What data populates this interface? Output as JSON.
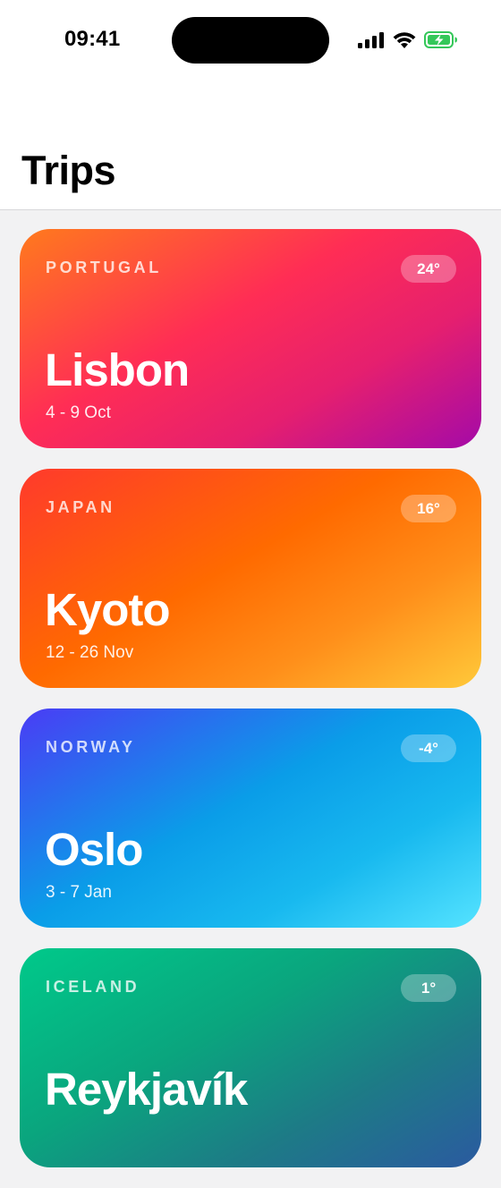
{
  "status_bar": {
    "time": "09:41",
    "icons": [
      "signal-icon",
      "wifi-icon",
      "battery-charging-icon"
    ],
    "battery_color": "#34c759"
  },
  "header": {
    "title": "Trips"
  },
  "trips": [
    {
      "country": "PORTUGAL",
      "city": "Lisbon",
      "dates": "4 - 9 Oct",
      "temperature": "24°",
      "gradient": [
        "#ff7a1d",
        "#ff2d55",
        "#a40aa8"
      ]
    },
    {
      "country": "JAPAN",
      "city": "Kyoto",
      "dates": "12 - 26 Nov",
      "temperature": "16°",
      "gradient": [
        "#ff3a2c",
        "#ff6a00",
        "#ffc93a"
      ]
    },
    {
      "country": "NORWAY",
      "city": "Oslo",
      "dates": "3 - 7 Jan",
      "temperature": "-4°",
      "gradient": [
        "#4a3cf5",
        "#0a9de8",
        "#55e3ff"
      ]
    },
    {
      "country": "ICELAND",
      "city": "Reykjavík",
      "dates": "",
      "temperature": "1°",
      "gradient": [
        "#00c98a",
        "#1d7b86",
        "#2b5aa0"
      ]
    }
  ]
}
